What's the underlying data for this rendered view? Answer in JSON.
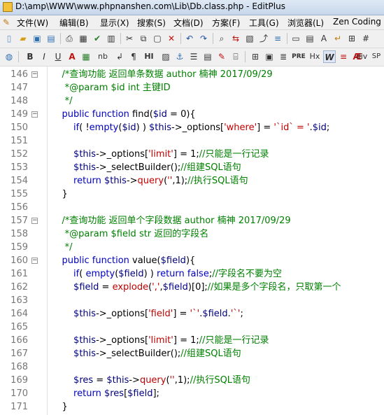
{
  "window": {
    "title": "D:\\amp\\WWW\\www.phpnanshen.com\\Lib\\Db.class.php - EditPlus"
  },
  "menu": [
    "文件(W)",
    "编辑(B)",
    "显示(X)",
    "搜索(S)",
    "文档(D)",
    "方案(F)",
    "工具(G)",
    "浏览器(L)",
    "Zen Coding"
  ],
  "toolbar2_labels": {
    "bold": "B",
    "italic": "I",
    "underline": "U",
    "font_color": "A",
    "nbsp": "nb",
    "para": "¶",
    "hr": "HI",
    "pre": "PRE",
    "hx": "Hx",
    "div": "div",
    "sp": "SP"
  },
  "lines": [
    {
      "n": "146",
      "fold": "−",
      "parts": [
        [
          "cm",
          "    /*查询功能 返回单条数据 author 楠神 2017/09/29"
        ]
      ]
    },
    {
      "n": "147",
      "fold": "",
      "parts": [
        [
          "cm",
          "     *@param $id int 主键ID"
        ]
      ]
    },
    {
      "n": "148",
      "fold": "",
      "parts": [
        [
          "cm",
          "     */"
        ]
      ]
    },
    {
      "n": "149",
      "fold": "−",
      "parts": [
        [
          "kw",
          "    public function "
        ],
        [
          "brace",
          "find("
        ],
        [
          "var",
          "$id"
        ],
        [
          "brace",
          " = 0){"
        ]
      ]
    },
    {
      "n": "150",
      "fold": "",
      "parts": [
        [
          "kw",
          "        if"
        ],
        [
          "brace",
          "( !"
        ],
        [
          "kw",
          "empty"
        ],
        [
          "brace",
          "("
        ],
        [
          "var",
          "$id"
        ],
        [
          "brace",
          ") ) "
        ],
        [
          "var",
          "$this"
        ],
        [
          "brace",
          "->_options["
        ],
        [
          "str",
          "'where'"
        ],
        [
          "brace",
          "] = "
        ],
        [
          "str",
          "'`id` = '"
        ],
        [
          "brace",
          "."
        ],
        [
          "var",
          "$id"
        ],
        [
          "brace",
          ";"
        ]
      ]
    },
    {
      "n": "151",
      "fold": "",
      "parts": [
        [
          "brace",
          ""
        ]
      ]
    },
    {
      "n": "152",
      "fold": "",
      "parts": [
        [
          "var",
          "        $this"
        ],
        [
          "brace",
          "->_options["
        ],
        [
          "str",
          "'limit'"
        ],
        [
          "brace",
          "] = 1;"
        ],
        [
          "cm",
          "//只能是一行记录"
        ]
      ]
    },
    {
      "n": "153",
      "fold": "",
      "parts": [
        [
          "var",
          "        $this"
        ],
        [
          "brace",
          "->_selectBuilder();"
        ],
        [
          "cm",
          "//组建SQL语句"
        ]
      ]
    },
    {
      "n": "154",
      "fold": "",
      "parts": [
        [
          "kw",
          "        return "
        ],
        [
          "var",
          "$this"
        ],
        [
          "brace",
          "->"
        ],
        [
          "fn",
          "query"
        ],
        [
          "brace",
          "("
        ],
        [
          "str",
          "''"
        ],
        [
          "brace",
          ",1);"
        ],
        [
          "cm",
          "//执行SQL语句"
        ]
      ]
    },
    {
      "n": "155",
      "fold": "",
      "parts": [
        [
          "brace",
          "    }"
        ]
      ]
    },
    {
      "n": "156",
      "fold": "",
      "parts": [
        [
          "brace",
          ""
        ]
      ]
    },
    {
      "n": "157",
      "fold": "−",
      "parts": [
        [
          "cm",
          "    /*查询功能 返回单个字段数据 author 楠神 2017/09/29"
        ]
      ]
    },
    {
      "n": "158",
      "fold": "",
      "parts": [
        [
          "cm",
          "     *@param $field str 返回的字段名"
        ]
      ]
    },
    {
      "n": "159",
      "fold": "",
      "parts": [
        [
          "cm",
          "     */"
        ]
      ]
    },
    {
      "n": "160",
      "fold": "−",
      "parts": [
        [
          "kw",
          "    public function "
        ],
        [
          "brace",
          "value("
        ],
        [
          "var",
          "$field"
        ],
        [
          "brace",
          "){"
        ]
      ]
    },
    {
      "n": "161",
      "fold": "",
      "parts": [
        [
          "kw",
          "        if"
        ],
        [
          "brace",
          "( "
        ],
        [
          "kw",
          "empty"
        ],
        [
          "brace",
          "("
        ],
        [
          "var",
          "$field"
        ],
        [
          "brace",
          ") ) "
        ],
        [
          "kw",
          "return false"
        ],
        [
          "brace",
          ";"
        ],
        [
          "cm",
          "//字段名不要为空"
        ]
      ]
    },
    {
      "n": "162",
      "fold": "",
      "parts": [
        [
          "var",
          "        $field"
        ],
        [
          "brace",
          " = "
        ],
        [
          "fn",
          "explode"
        ],
        [
          "brace",
          "("
        ],
        [
          "str",
          "','"
        ],
        [
          "brace",
          ","
        ],
        [
          "var",
          "$field"
        ],
        [
          "brace",
          ")[0];"
        ],
        [
          "cm",
          "//如果是多个字段名，只取第一个"
        ]
      ]
    },
    {
      "n": "163",
      "fold": "",
      "parts": [
        [
          "brace",
          ""
        ]
      ]
    },
    {
      "n": "164",
      "fold": "",
      "parts": [
        [
          "var",
          "        $this"
        ],
        [
          "brace",
          "->_options["
        ],
        [
          "str",
          "'field'"
        ],
        [
          "brace",
          "] = "
        ],
        [
          "str",
          "'`'"
        ],
        [
          "brace",
          "."
        ],
        [
          "var",
          "$field"
        ],
        [
          "brace",
          "."
        ],
        [
          "str",
          "'`'"
        ],
        [
          "brace",
          ";"
        ]
      ]
    },
    {
      "n": "165",
      "fold": "",
      "parts": [
        [
          "brace",
          ""
        ]
      ]
    },
    {
      "n": "166",
      "fold": "",
      "parts": [
        [
          "var",
          "        $this"
        ],
        [
          "brace",
          "->_options["
        ],
        [
          "str",
          "'limit'"
        ],
        [
          "brace",
          "] = 1;"
        ],
        [
          "cm",
          "//只能是一行记录"
        ]
      ]
    },
    {
      "n": "167",
      "fold": "",
      "parts": [
        [
          "var",
          "        $this"
        ],
        [
          "brace",
          "->_selectBuilder();"
        ],
        [
          "cm",
          "//组建SQL语句"
        ]
      ]
    },
    {
      "n": "168",
      "fold": "",
      "parts": [
        [
          "brace",
          ""
        ]
      ]
    },
    {
      "n": "169",
      "fold": "",
      "parts": [
        [
          "var",
          "        $res"
        ],
        [
          "brace",
          " = "
        ],
        [
          "var",
          "$this"
        ],
        [
          "brace",
          "->"
        ],
        [
          "fn",
          "query"
        ],
        [
          "brace",
          "("
        ],
        [
          "str",
          "''"
        ],
        [
          "brace",
          ",1);"
        ],
        [
          "cm",
          "//执行SQL语句"
        ]
      ]
    },
    {
      "n": "170",
      "fold": "",
      "parts": [
        [
          "kw",
          "        return "
        ],
        [
          "var",
          "$res"
        ],
        [
          "brace",
          "["
        ],
        [
          "var",
          "$field"
        ],
        [
          "brace",
          "];"
        ]
      ]
    },
    {
      "n": "171",
      "fold": "",
      "parts": [
        [
          "brace",
          "    }"
        ]
      ]
    }
  ]
}
